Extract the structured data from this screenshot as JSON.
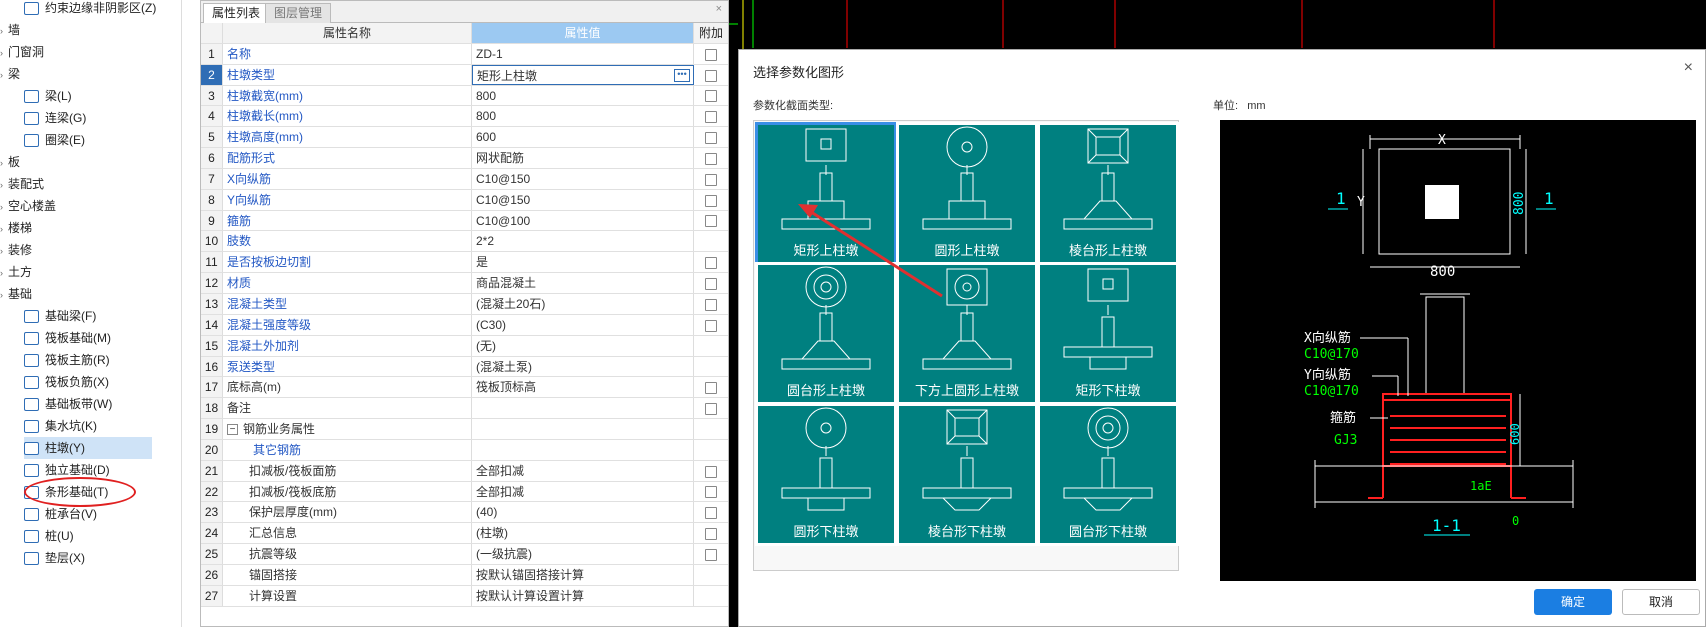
{
  "tree": {
    "items": [
      {
        "label": "约束边缘非阴影区(Z)",
        "level": 2,
        "icon": "edge-zone-icon"
      },
      {
        "label": "墙",
        "level": 1
      },
      {
        "label": "门窗洞",
        "level": 1
      },
      {
        "label": "梁",
        "level": 1
      },
      {
        "label": "梁(L)",
        "level": 2,
        "icon": "beam-icon"
      },
      {
        "label": "连梁(G)",
        "level": 2,
        "icon": "link-beam-icon"
      },
      {
        "label": "圈梁(E)",
        "level": 2,
        "icon": "ring-beam-icon"
      },
      {
        "label": "板",
        "level": 1
      },
      {
        "label": "装配式",
        "level": 1
      },
      {
        "label": "空心楼盖",
        "level": 1
      },
      {
        "label": "楼梯",
        "level": 1
      },
      {
        "label": "装修",
        "level": 1
      },
      {
        "label": "土方",
        "level": 1
      },
      {
        "label": "基础",
        "level": 1
      },
      {
        "label": "基础梁(F)",
        "level": 2,
        "icon": "foundation-beam-icon"
      },
      {
        "label": "筏板基础(M)",
        "level": 2,
        "icon": "raft-foundation-icon"
      },
      {
        "label": "筏板主筋(R)",
        "level": 2,
        "icon": "raft-main-rebar-icon"
      },
      {
        "label": "筏板负筋(X)",
        "level": 2,
        "icon": "raft-neg-rebar-icon"
      },
      {
        "label": "基础板带(W)",
        "level": 2,
        "icon": "foundation-strip-icon"
      },
      {
        "label": "集水坑(K)",
        "level": 2,
        "icon": "sump-pit-icon"
      },
      {
        "label": "柱墩(Y)",
        "level": 2,
        "icon": "column-pier-icon",
        "selected": true
      },
      {
        "label": "独立基础(D)",
        "level": 2,
        "icon": "isolated-footing-icon"
      },
      {
        "label": "条形基础(T)",
        "level": 2,
        "icon": "strip-footing-icon"
      },
      {
        "label": "桩承台(V)",
        "level": 2,
        "icon": "pile-cap-icon"
      },
      {
        "label": "桩(U)",
        "level": 2,
        "icon": "pile-icon"
      },
      {
        "label": "垫层(X)",
        "level": 2,
        "icon": "cushion-icon"
      }
    ]
  },
  "props": {
    "tab_active": "属性列表",
    "tab_other": "图层管理",
    "close_glyph": "×",
    "header": {
      "name": "属性名称",
      "value": "属性值",
      "extra": "附加"
    },
    "rows": [
      {
        "n": "1",
        "k": "名称",
        "v": "ZD-1",
        "cb": true
      },
      {
        "n": "2",
        "k": "柱墩类型",
        "v": "矩形上柱墩",
        "cb": true,
        "current": true
      },
      {
        "n": "3",
        "k": "柱墩截宽(mm)",
        "v": "800",
        "cb": true
      },
      {
        "n": "4",
        "k": "柱墩截长(mm)",
        "v": "800",
        "cb": true
      },
      {
        "n": "5",
        "k": "柱墩高度(mm)",
        "v": "600",
        "cb": true
      },
      {
        "n": "6",
        "k": "配筋形式",
        "v": "网状配筋",
        "cb": true
      },
      {
        "n": "7",
        "k": "X向纵筋",
        "v": "C10@150",
        "cb": true
      },
      {
        "n": "8",
        "k": "Y向纵筋",
        "v": "C10@150",
        "cb": true
      },
      {
        "n": "9",
        "k": "箍筋",
        "v": "C10@100",
        "cb": true
      },
      {
        "n": "10",
        "k": "肢数",
        "v": "2*2",
        "cb": false
      },
      {
        "n": "11",
        "k": "是否按板边切割",
        "v": "是",
        "cb": true
      },
      {
        "n": "12",
        "k": "材质",
        "v": "商品混凝土",
        "cb": true
      },
      {
        "n": "13",
        "k": "混凝土类型",
        "v": "(混凝土20石)",
        "cb": true
      },
      {
        "n": "14",
        "k": "混凝土强度等级",
        "v": "(C30)",
        "cb": true
      },
      {
        "n": "15",
        "k": "混凝土外加剂",
        "v": "(无)",
        "cb": false
      },
      {
        "n": "16",
        "k": "泵送类型",
        "v": "(混凝土泵)",
        "cb": false
      },
      {
        "n": "17",
        "k": "底标高(m)",
        "v": "筏板顶标高",
        "cb": true,
        "g": true
      },
      {
        "n": "18",
        "k": "备注",
        "v": "",
        "cb": true,
        "g": true
      },
      {
        "n": "19",
        "k": "钢筋业务属性",
        "v": "",
        "cb": false,
        "g": true,
        "group": true
      },
      {
        "n": "20",
        "k": "其它钢筋",
        "v": "",
        "cb": false,
        "sub": true,
        "blue": true
      },
      {
        "n": "21",
        "k": "扣减板/筏板面筋",
        "v": "全部扣减",
        "cb": true,
        "sub": true,
        "g": true
      },
      {
        "n": "22",
        "k": "扣减板/筏板底筋",
        "v": "全部扣减",
        "cb": true,
        "sub": true,
        "g": true
      },
      {
        "n": "23",
        "k": "保护层厚度(mm)",
        "v": "(40)",
        "cb": true,
        "sub": true,
        "g": true
      },
      {
        "n": "24",
        "k": "汇总信息",
        "v": "(柱墩)",
        "cb": true,
        "sub": true,
        "g": true
      },
      {
        "n": "25",
        "k": "抗震等级",
        "v": "(一级抗震)",
        "cb": true,
        "sub": true,
        "g": true
      },
      {
        "n": "26",
        "k": "锚固搭接",
        "v": "按默认锚固搭接计算",
        "cb": false,
        "sub": true,
        "g": true
      },
      {
        "n": "27",
        "k": "计算设置",
        "v": "按默认计算设置计算",
        "cb": false,
        "sub": true,
        "g": true
      }
    ]
  },
  "dialog": {
    "title": "选择参数化图形",
    "close_glyph": "×",
    "section_label": "参数化截面类型:",
    "unit_label": "单位:",
    "unit_value": "mm",
    "tiles": [
      {
        "label": "矩形上柱墩",
        "top": "rect",
        "pier": "rect",
        "upper": true,
        "selected": true
      },
      {
        "label": "圆形上柱墩",
        "top": "circle",
        "pier": "rect",
        "upper": true
      },
      {
        "label": "棱台形上柱墩",
        "top": "frustum",
        "pier": "trap",
        "upper": true
      },
      {
        "label": "圆台形上柱墩",
        "top": "dcircle",
        "pier": "trap",
        "upper": true
      },
      {
        "label": "下方上圆形上柱墩",
        "top": "sqcircle",
        "pier": "trap",
        "upper": true
      },
      {
        "label": "矩形下柱墩",
        "top": "rect",
        "pier": "rect",
        "upper": false
      },
      {
        "label": "圆形下柱墩",
        "top": "circle",
        "pier": "rect",
        "upper": false
      },
      {
        "label": "棱台形下柱墩",
        "top": "frustum",
        "pier": "trap",
        "upper": false
      },
      {
        "label": "圆台形下柱墩",
        "top": "dcircle",
        "pier": "trap",
        "upper": false
      }
    ],
    "ok_label": "确定",
    "cancel_label": "取消"
  },
  "preview": {
    "dim_x": "X",
    "dim_y": "Y",
    "dim_width": "800",
    "dim_height": "800",
    "section_mark": "1",
    "x_rebar_label": "X向纵筋",
    "x_rebar_value": "C10@170",
    "y_rebar_label": "Y向纵筋",
    "y_rebar_value": "C10@170",
    "stirrup_label": "箍筋",
    "stirrup_value": "GJ3",
    "pier_height": "600",
    "anchor_label": "1aE",
    "zero_label": "0",
    "section_title": "1-1"
  },
  "colors": {
    "tile_bg": "#008080",
    "selected_border": "#3a8ee6",
    "link_blue": "#2358c4",
    "rebar_red": "#ff2020",
    "rebar_green": "#00ff00",
    "dim_cyan": "#00ffff"
  }
}
